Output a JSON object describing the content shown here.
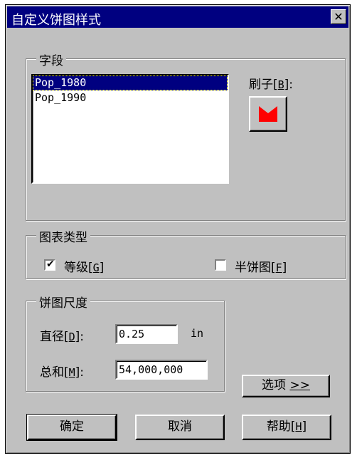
{
  "window": {
    "title": "自定义饼图样式",
    "close_glyph": "✕"
  },
  "fields_group": {
    "legend": "字段",
    "items": [
      {
        "label": "Pop_1980",
        "selected": true
      },
      {
        "label": "Pop_1990",
        "selected": false
      }
    ],
    "brush_label_prefix": "刷子[",
    "brush_label_key": "B",
    "brush_label_suffix": "]:",
    "brush_color": "#ff0000"
  },
  "chart_type_group": {
    "legend": "图表类型",
    "graduated": {
      "prefix": "等级[",
      "key": "G",
      "suffix": "]",
      "checked": true,
      "mark": "✔"
    },
    "half_pie": {
      "prefix": "半饼图[",
      "key": "F",
      "suffix": "]",
      "checked": false
    }
  },
  "size_group": {
    "legend": "饼图尺度",
    "diameter": {
      "prefix": "直径[",
      "key": "D",
      "suffix": "]:",
      "value": "0.25",
      "unit": "in"
    },
    "total": {
      "prefix": "总和[",
      "key": "M",
      "suffix": "]:",
      "value": "54,000,000"
    }
  },
  "buttons": {
    "options": {
      "label": "选项",
      "accel": ">>"
    },
    "ok": "确定",
    "cancel": "取消",
    "help": {
      "prefix": "帮助[",
      "key": "H",
      "suffix": "]"
    }
  }
}
